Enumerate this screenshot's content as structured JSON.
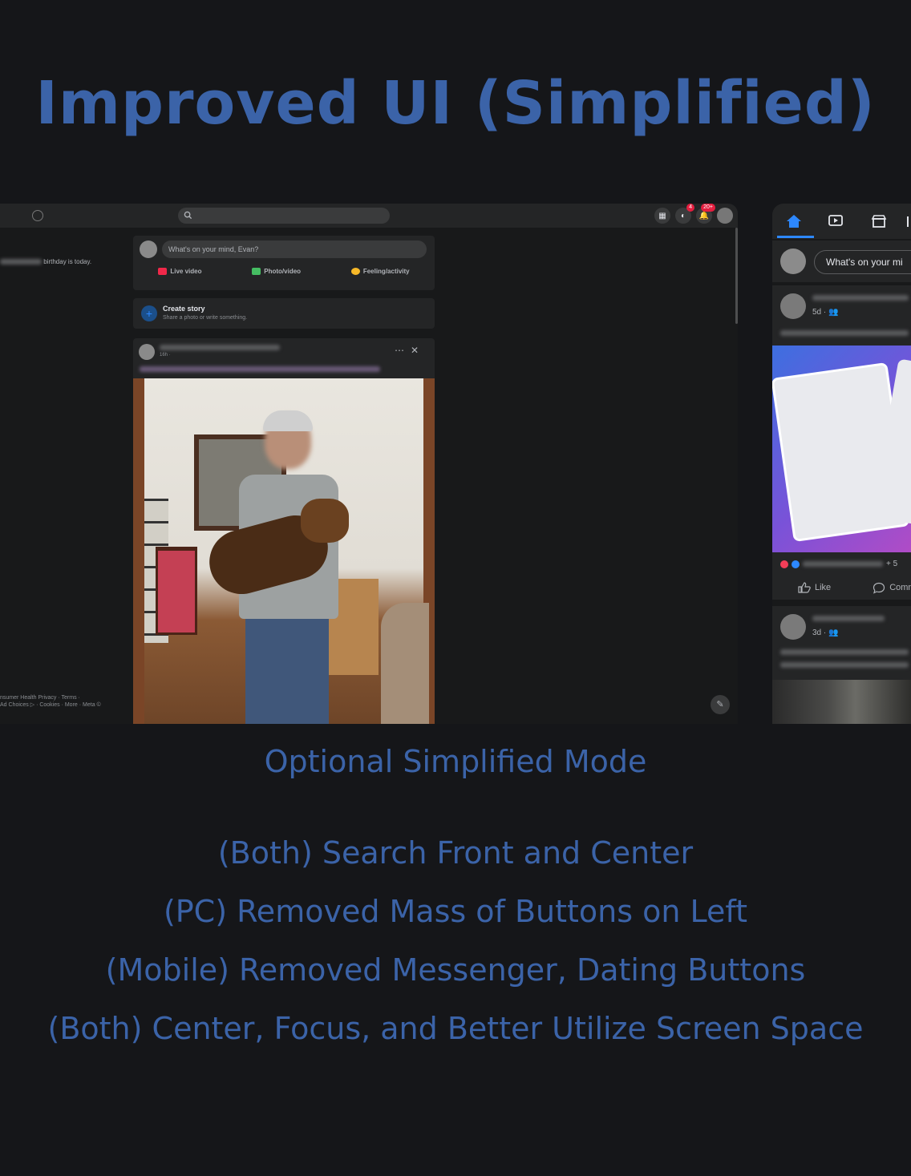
{
  "title": "Improved UI (Simplified)",
  "pc": {
    "composer": {
      "placeholder": "What's on your mind, Evan?",
      "actions": [
        "Live video",
        "Photo/video",
        "Feeling/activity"
      ],
      "action_colors": [
        "#f02849",
        "#45bd62",
        "#f7b928"
      ]
    },
    "story": {
      "title": "Create story",
      "subtitle": "Share a photo or write something."
    },
    "post": {
      "time": "16h ·"
    },
    "left": {
      "birthday": "birthday is today.",
      "footer_line1": "nsumer Health Privacy · Terms ·",
      "footer_line2": "Ad Choices ▷ · Cookies · More · Meta ©"
    },
    "badges": {
      "messenger": "4",
      "notifications": "20+"
    },
    "accent": "#2d88ff"
  },
  "mobile": {
    "composer_placeholder": "What's on your mi",
    "post1": {
      "time": "5d ·"
    },
    "post1_reactions_more": "+ 5",
    "actions": [
      "Like",
      "Comm"
    ],
    "post2": {
      "time": "3d ·"
    }
  },
  "captions": {
    "subtitle": "Optional Simplified Mode",
    "bullets": [
      "(Both) Search Front and Center",
      "(PC) Removed Mass of Buttons on Left",
      "(Mobile) Removed Messenger, Dating Buttons",
      "(Both) Center, Focus, and Better Utilize Screen Space"
    ]
  },
  "colors": {
    "title": "#3b63a8",
    "background": "#151619"
  }
}
